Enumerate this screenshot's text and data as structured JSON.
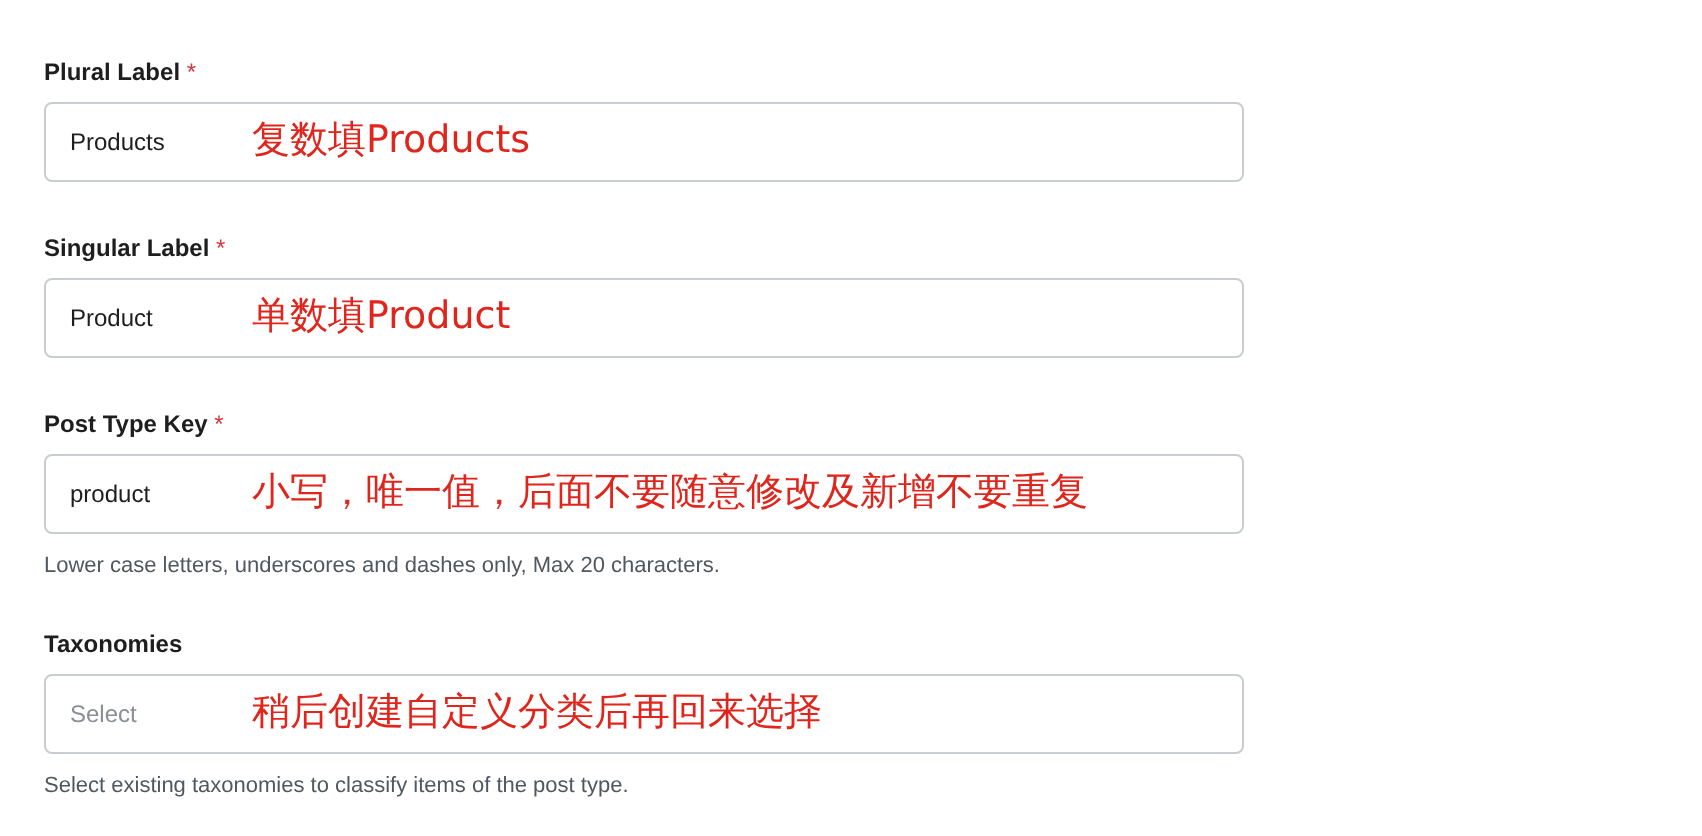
{
  "fields": [
    {
      "label": "Plural Label",
      "required_mark": "*",
      "value": "Products",
      "annotation": "复数填Products"
    },
    {
      "label": "Singular Label",
      "required_mark": "*",
      "value": "Product",
      "annotation": "单数填Product"
    },
    {
      "label": "Post Type Key",
      "required_mark": "*",
      "value": "product",
      "annotation": "小写，唯一值，后面不要随意修改及新增不要重复",
      "hint": "Lower case letters, underscores and dashes only, Max 20 characters."
    },
    {
      "label": "Taxonomies",
      "placeholder": "Select",
      "annotation": "稍后创建自定义分类后再回来选择",
      "hint": "Select existing taxonomies to classify items of the post type."
    }
  ]
}
